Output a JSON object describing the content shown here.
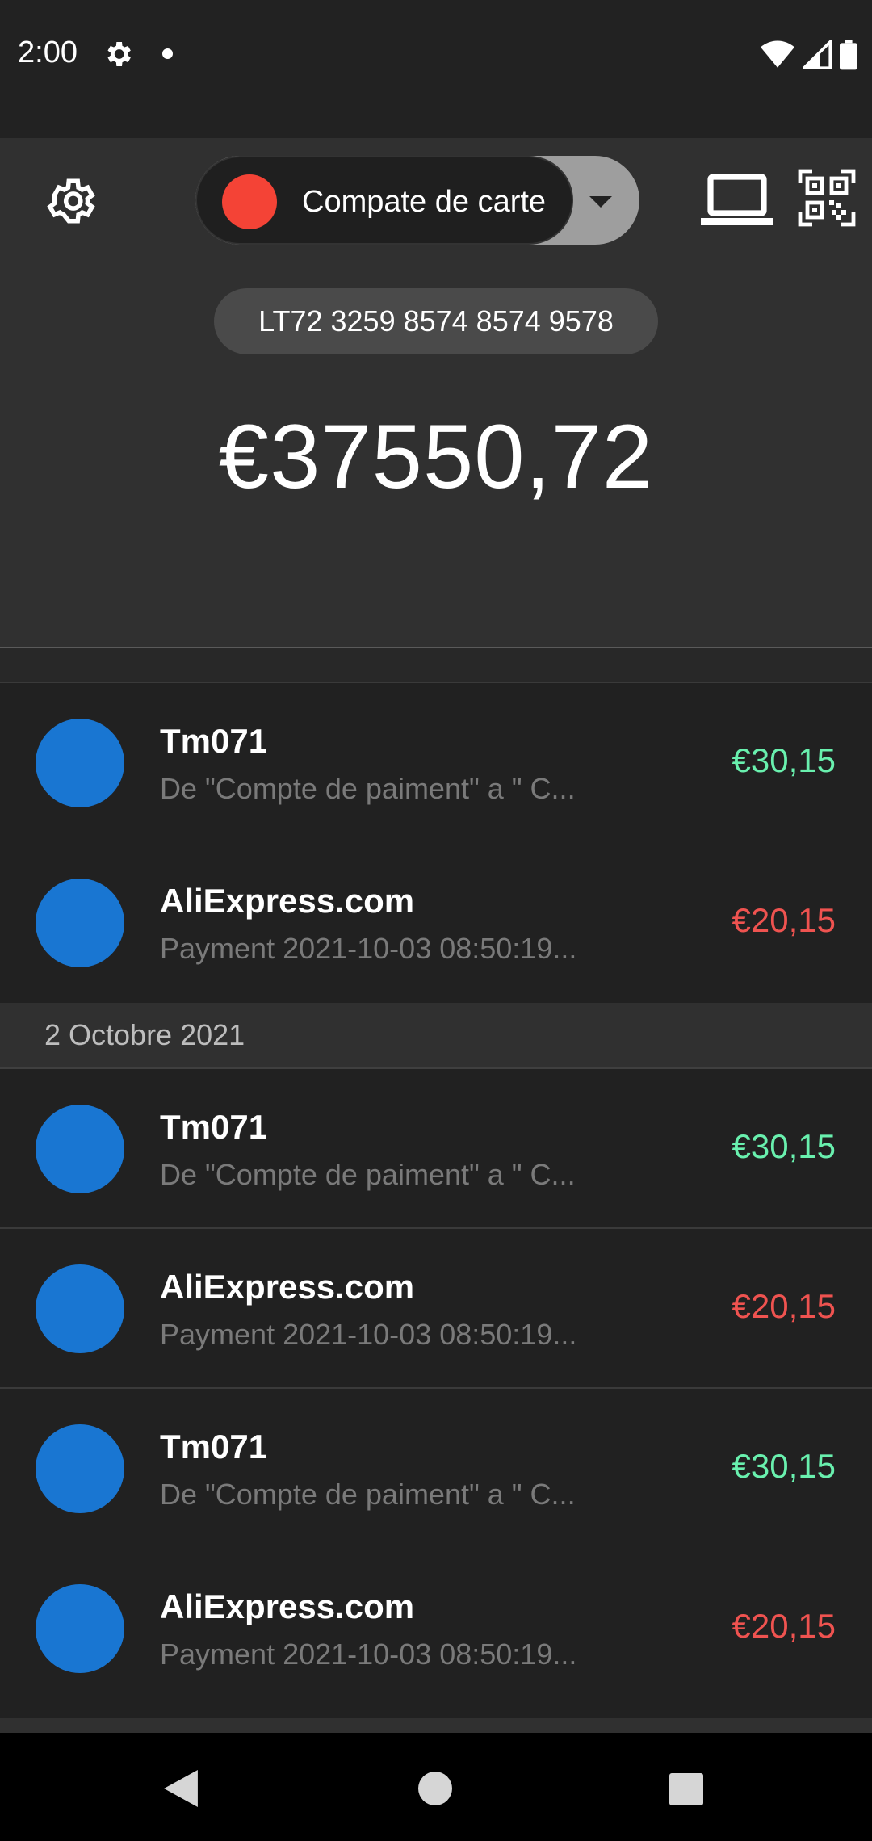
{
  "status_bar": {
    "time": "2:00",
    "icons": [
      "settings-gear-icon",
      "notification-dot-icon",
      "wifi-icon",
      "signal-icon",
      "battery-icon"
    ]
  },
  "header": {
    "account_name": "Compate de carte",
    "iban": "LT72 3259 8574 8574 9578",
    "balance": "€37550,72",
    "icons": [
      "gear-icon",
      "chevron-down-icon",
      "laptop-icon",
      "qr-code-icon"
    ],
    "colors": {
      "account_dot": "#f44336",
      "background": "#303030"
    }
  },
  "transactions_top": [
    {
      "title": "Tm071",
      "subtitle": "De \"Compte de paiment\" a \" C...",
      "amount": "€30,15",
      "direction": "in"
    },
    {
      "title": "AliExpress.com",
      "subtitle": "Payment 2021-10-03 08:50:19...",
      "amount": "€20,15",
      "direction": "out"
    }
  ],
  "date_group": {
    "label": "2 Octobre 2021",
    "transactions": [
      {
        "title": "Tm071",
        "subtitle": "De \"Compte de paiment\" a \" C...",
        "amount": "€30,15",
        "direction": "in"
      },
      {
        "title": "AliExpress.com",
        "subtitle": "Payment 2021-10-03 08:50:19...",
        "amount": "€20,15",
        "direction": "out"
      },
      {
        "title": "Tm071",
        "subtitle": "De \"Compte de paiment\" a \" C...",
        "amount": "€30,15",
        "direction": "in"
      },
      {
        "title": "AliExpress.com",
        "subtitle": "Payment 2021-10-03 08:50:19...",
        "amount": "€20,15",
        "direction": "out"
      }
    ]
  },
  "colors": {
    "amount_in": "#69f0ae",
    "amount_out": "#ef5350",
    "avatar": "#1976d2"
  },
  "nav_bar": {
    "icons": [
      "back-icon",
      "home-icon",
      "recents-icon"
    ]
  }
}
